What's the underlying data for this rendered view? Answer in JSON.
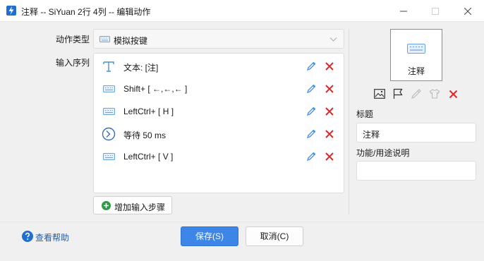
{
  "window": {
    "title": "注释 -- SiYuan 2行 4列 -- 编辑动作",
    "icon": "app-logo-icon"
  },
  "form": {
    "action_type_label": "动作类型",
    "action_type_value": "模拟按键",
    "input_sequence_label": "输入序列",
    "steps": [
      {
        "icon": "text-icon",
        "text": "文本: [注]"
      },
      {
        "icon": "keyboard-icon",
        "text": "Shift+ [ ←,←,← ]"
      },
      {
        "icon": "keyboard-icon",
        "text": "LeftCtrl+ [ H ]"
      },
      {
        "icon": "clock-icon",
        "text": "等待 50 ms"
      },
      {
        "icon": "keyboard-icon",
        "text": "LeftCtrl+ [ V ]"
      }
    ],
    "add_step_label": "增加输入步骤"
  },
  "side": {
    "preview_caption": "注释",
    "title_label": "标题",
    "title_value": "注释",
    "description_label": "功能/用途说明",
    "description_value": ""
  },
  "footer": {
    "help_label": "查看帮助",
    "save_label": "保存(S)",
    "cancel_label": "取消(C)"
  },
  "colors": {
    "accent": "#3d86e8",
    "delete": "#d92b2b",
    "edit": "#4a8fd8",
    "link": "#1f5ea8"
  }
}
